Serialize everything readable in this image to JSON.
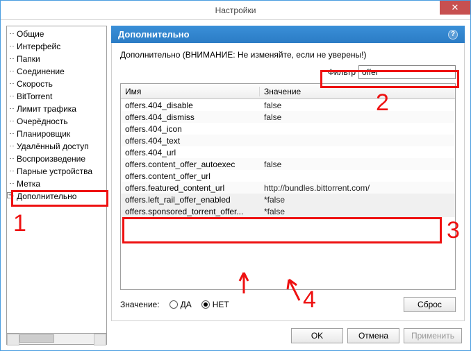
{
  "window": {
    "title": "Настройки"
  },
  "sidebar": {
    "items": [
      {
        "label": "Общие"
      },
      {
        "label": "Интерфейс"
      },
      {
        "label": "Папки"
      },
      {
        "label": "Соединение"
      },
      {
        "label": "Скорость"
      },
      {
        "label": "BitTorrent"
      },
      {
        "label": "Лимит трафика"
      },
      {
        "label": "Очерёдность"
      },
      {
        "label": "Планировщик"
      },
      {
        "label": "Удалённый доступ"
      },
      {
        "label": "Воспроизведение"
      },
      {
        "label": "Парные устройства"
      },
      {
        "label": "Метка"
      },
      {
        "label": "Дополнительно",
        "expandable": true
      }
    ]
  },
  "panel": {
    "title": "Дополнительно",
    "warning": "Дополнительно (ВНИМАНИЕ: Не изменяйте, если не уверены!)",
    "filter_label": "Фильтр",
    "filter_value": "offer",
    "columns": {
      "name": "Имя",
      "value": "Значение"
    },
    "rows": [
      {
        "name": "offers.404_disable",
        "value": "false"
      },
      {
        "name": "offers.404_dismiss",
        "value": "false"
      },
      {
        "name": "offers.404_icon",
        "value": ""
      },
      {
        "name": "offers.404_text",
        "value": ""
      },
      {
        "name": "offers.404_url",
        "value": ""
      },
      {
        "name": "offers.content_offer_autoexec",
        "value": "false"
      },
      {
        "name": "offers.content_offer_url",
        "value": ""
      },
      {
        "name": "offers.featured_content_url",
        "value": "http://bundles.bittorrent.com/"
      },
      {
        "name": "offers.left_rail_offer_enabled",
        "value": "*false"
      },
      {
        "name": "offers.sponsored_torrent_offer...",
        "value": "*false"
      }
    ],
    "value_label": "Значение:",
    "radio_yes": "ДА",
    "radio_no": "НЕТ",
    "reset": "Сброс"
  },
  "footer": {
    "ok": "OK",
    "cancel": "Отмена",
    "apply": "Применить"
  },
  "annotations": {
    "n1": "1",
    "n2": "2",
    "n3": "3",
    "n4": "4"
  }
}
